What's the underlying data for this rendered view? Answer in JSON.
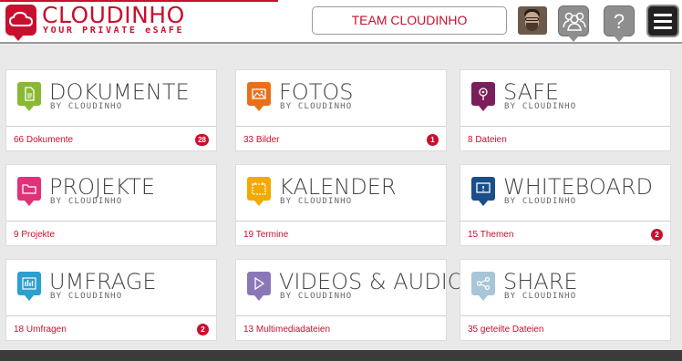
{
  "header": {
    "logo_title": "CLOUDINHO",
    "logo_subtitle": "YOUR PRIVATE eSAFE",
    "team_button": "TEAM CLOUDINHO",
    "help_glyph": "?",
    "brand_color": "#c8102e"
  },
  "tiles": [
    {
      "title": "DOKUMENTE",
      "by": "BY CLOUDINHO",
      "count": "66 Dokumente",
      "badge": "28",
      "icon": "document-icon",
      "color": "#8ab833"
    },
    {
      "title": "FOTOS",
      "by": "BY CLOUDINHO",
      "count": "33 Bilder",
      "badge": "1",
      "icon": "image-icon",
      "color": "#e8701a"
    },
    {
      "title": "SAFE",
      "by": "BY CLOUDINHO",
      "count": "8 Dateien",
      "badge": "",
      "icon": "safe-icon",
      "color": "#7b1f5c"
    },
    {
      "title": "PROJEKTE",
      "by": "BY CLOUDINHO",
      "count": "9 Projekte",
      "badge": "",
      "icon": "folder-icon",
      "color": "#e0317a"
    },
    {
      "title": "KALENDER",
      "by": "BY CLOUDINHO",
      "count": "19 Termine",
      "badge": "",
      "icon": "calendar-icon",
      "color": "#f2a900"
    },
    {
      "title": "WHITEBOARD",
      "by": "BY CLOUDINHO",
      "count": "15 Themen",
      "badge": "2",
      "icon": "whiteboard-icon",
      "color": "#1b4f8a"
    },
    {
      "title": "UMFRAGE",
      "by": "BY CLOUDINHO",
      "count": "18 Umfragen",
      "badge": "2",
      "icon": "poll-icon",
      "color": "#2a9fd0"
    },
    {
      "title": "VIDEOS & AUDIO",
      "by": "BY CLOUDINHO",
      "count": "13 Multimediadateien",
      "badge": "",
      "icon": "play-icon",
      "color": "#8a77b8"
    },
    {
      "title": "SHARE",
      "by": "BY CLOUDINHO",
      "count": "35 geteilte Dateien",
      "badge": "",
      "icon": "share-icon",
      "color": "#a7c6d8"
    }
  ]
}
